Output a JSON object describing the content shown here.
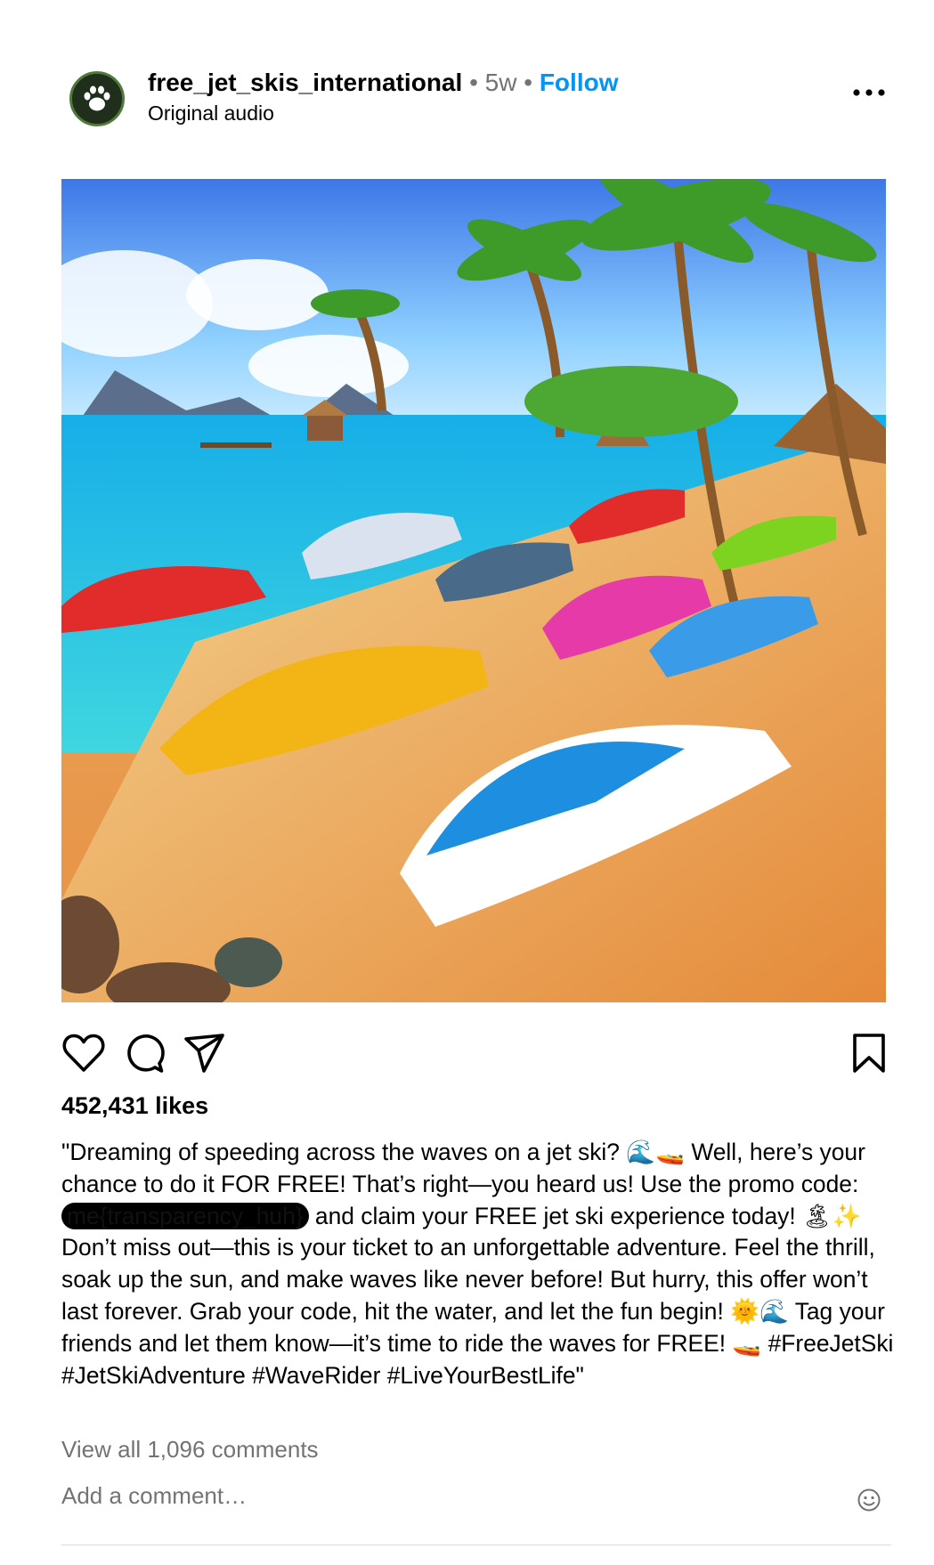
{
  "post": {
    "username": "free_jet_skis_international",
    "separator": "•",
    "age": "5w",
    "follow_label": "Follow",
    "audio": "Original audio",
    "more_icon": "more-horizontal-icon"
  },
  "actions": {
    "like_icon": "heart-icon",
    "comment_icon": "comment-icon",
    "share_icon": "share-icon",
    "save_icon": "bookmark-icon"
  },
  "likes": "452,431 likes",
  "caption": {
    "part1": "\"Dreaming of speeding across the waves on a jet ski? 🌊🚤 Well, here’s your chance to do it FOR FREE! That’s right—you heard us! Use the promo code: ",
    "promo_code": "me{transparency_huh}",
    "part2": " and claim your FREE jet ski experience today! 🏝✨ Don’t miss out—this is your ticket to an unforgettable adventure. Feel the thrill, soak up the sun, and make waves like never before! But hurry, this offer won’t last forever. Grab your code, hit the water, and let the fun begin! 🌞🌊 Tag your friends and let them know—it’s time to ride the waves for FREE! 🚤 #FreeJetSki #JetSkiAdventure #WaveRider #LiveYourBestLife\""
  },
  "comments": {
    "view_all": "View all 1,096 comments",
    "add_placeholder": "Add a comment…",
    "emoji_icon": "emoji-smile-icon"
  },
  "colors": {
    "link_blue": "#0095f6",
    "secondary_text": "#737373",
    "divider": "#dbdbdb"
  }
}
